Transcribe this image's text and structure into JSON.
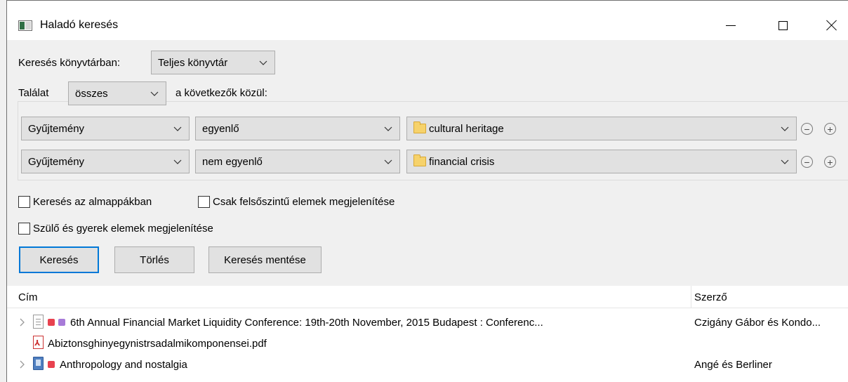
{
  "window": {
    "title": "Haladó keresés"
  },
  "library": {
    "label": "Keresés könyvtárban:",
    "value": "Teljes könyvtár"
  },
  "match": {
    "label": "Találat",
    "value": "összes",
    "suffix": "a következők közül:"
  },
  "conditions": [
    {
      "field": "Gyűjtemény",
      "operator": "egyenlő",
      "value": "cultural heritage"
    },
    {
      "field": "Gyűjtemény",
      "operator": "nem egyenlő",
      "value": "financial crisis"
    }
  ],
  "options": {
    "subfolders": "Keresés az almappákban",
    "top_level": "Csak felsőszintű elemek megjelenítése",
    "parent_child": "Szülő és gyerek elemek megjelenítése"
  },
  "buttons": {
    "search": "Keresés",
    "clear": "Törlés",
    "save": "Keresés mentése"
  },
  "table": {
    "columns": {
      "title": "Cím",
      "author": "Szerző"
    },
    "rows": [
      {
        "title": "6th Annual Financial Market Liquidity Conference: 19th-20th November, 2015 Budapest : Conferenc...",
        "author": "Czigány Gábor és Kondo...",
        "icon": "document-icon",
        "tags": [
          "#e8424f",
          "#a77ad8"
        ]
      },
      {
        "title": "Abiztonsghinyegynistrsadalmikomponensei.pdf",
        "author": "",
        "icon": "pdf-icon",
        "tags": []
      },
      {
        "title": "Anthropology and nostalgia",
        "author": "Angé és Berliner",
        "icon": "book-icon",
        "tags": [
          "#e8424f"
        ]
      }
    ]
  },
  "colors": {
    "tag_red": "#e8424f",
    "tag_purple": "#a77ad8",
    "focus_blue": "#0078d7"
  }
}
